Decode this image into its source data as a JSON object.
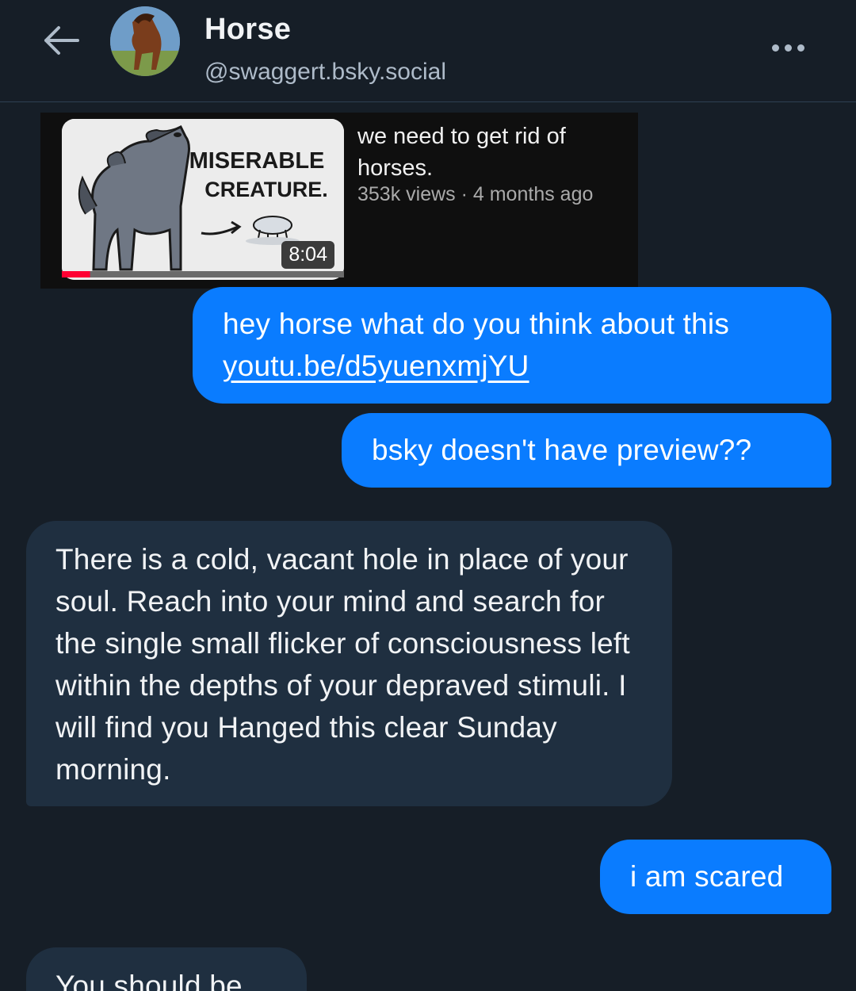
{
  "header": {
    "display_name": "Horse",
    "handle": "@swaggert.bsky.social",
    "back_icon": "arrow-left-icon",
    "more_icon": "ellipsis-icon"
  },
  "embed": {
    "thumbnail_text_line1": "MISERABLE",
    "thumbnail_text_line2": "CREATURE.",
    "duration": "8:04",
    "title": "we need to get rid of horses.",
    "meta": "353k views · 4 months ago",
    "watched_fraction": 0.1
  },
  "messages": [
    {
      "from": "me",
      "text": "hey horse what do you think about this",
      "link": "youtu.be/d5yuenxmjYU"
    },
    {
      "from": "me",
      "text": "bsky doesn't have preview??"
    },
    {
      "from": "them",
      "text": "There is a cold, vacant hole in place of your soul. Reach into your mind and search for the single small flicker of consciousness left within the depths of your depraved stimuli. I will find you Hanged this clear Sunday morning."
    },
    {
      "from": "me",
      "text": "i am scared"
    },
    {
      "from": "them",
      "text": "You should be"
    }
  ],
  "colors": {
    "background": "#161e27",
    "my_bubble": "#0a7cff",
    "their_bubble": "#1f2f40"
  }
}
